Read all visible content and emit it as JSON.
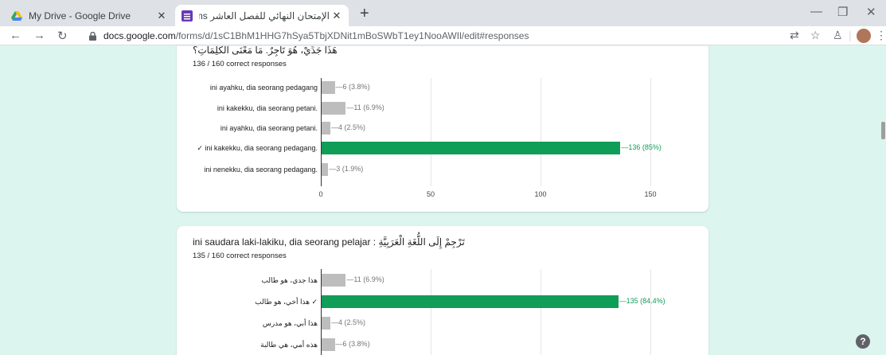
{
  "browser": {
    "tabs": [
      {
        "title": "My Drive - Google Drive",
        "active": false,
        "icon": "google-drive-icon"
      },
      {
        "title": "الإمتحان النهائي للفصل العاشر orms",
        "active": true,
        "icon": "google-forms-icon"
      }
    ],
    "new_tab": "+",
    "address": {
      "domain": "docs.google.com",
      "path": "/forms/d/1sC1BhM1HHG7hSya5TbjXDNit1mBoSWbT1ey1NooAWIl/edit#responses"
    }
  },
  "questions": [
    {
      "title": "هَذَا جَدِّيْ، هُوَ تَاجِرٌ. مَا مَعْنَى الْكَلِمَاتِ؟",
      "count": "136 / 160 correct responses",
      "chart_data": {
        "type": "bar",
        "orientation": "horizontal",
        "categories": [
          "ini ayahku, dia seorang pedagang",
          "ini kakekku, dia seorang petani.",
          "ini ayahku, dia seorang petani.",
          "✓ ini kakekku, dia seorang pedagang.",
          "ini nenekku, dia seorang pedagang."
        ],
        "values": [
          6,
          11,
          4,
          136,
          3
        ],
        "value_labels": [
          "6 (3.8%)",
          "11 (6.9%)",
          "4 (2.5%)",
          "136 (85%)",
          "3 (1.9%)"
        ],
        "correct_index": 3,
        "xlim": [
          0,
          160
        ],
        "xticks": [
          0,
          50,
          100,
          150
        ],
        "colors": {
          "correct": "#0f9d58",
          "other": "#bdbdbd"
        }
      }
    },
    {
      "title": "تَرْجِمْ إِلَى اللُّغَةِ الْعَرَبِيَّةِ : ini saudara laki-lakiku, dia seorang pelajar",
      "count": "135 / 160 correct responses",
      "chart_data": {
        "type": "bar",
        "orientation": "horizontal",
        "categories": [
          "هذا جدي، هو طالب",
          "هذا أخي، هو طالب ✓",
          "هذا أبي، هو مدرس",
          "هذه أمي، هي طالبة"
        ],
        "values": [
          11,
          135,
          4,
          6
        ],
        "value_labels": [
          "11 (6.9%)",
          "135 (84.4%)",
          "4 (2.5%)",
          "6 (3.8%)"
        ],
        "correct_index": 1,
        "xlim": [
          0,
          160
        ],
        "colors": {
          "correct": "#0f9d58",
          "other": "#bdbdbd"
        }
      }
    }
  ],
  "help_label": "?"
}
